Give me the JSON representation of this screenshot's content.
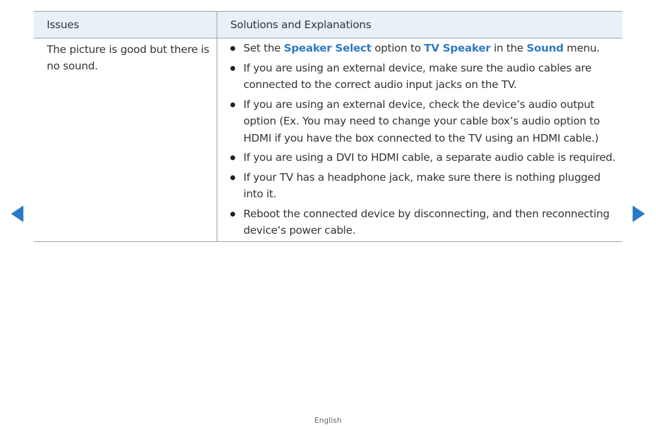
{
  "table": {
    "headers": {
      "issues": "Issues",
      "solutions": "Solutions and Explanations"
    },
    "row": {
      "issue": "The picture is good but there is no sound.",
      "item1": {
        "pre": "Set the ",
        "term1": "Speaker Select",
        "mid1": " option to ",
        "term2": "TV Speaker",
        "mid2": " in the ",
        "term3": "Sound",
        "post": " menu."
      },
      "item2": "If you are using an external device, make sure the audio cables are connected to the correct audio input jacks on the TV.",
      "item3": "If you are using an external device, check the device’s audio output option (Ex. You may need to change your cable box’s audio option to HDMI if you have the box connected to the TV using an HDMI cable.)",
      "item4": "If you are using a DVI to HDMI cable, a separate audio cable is required.",
      "item5": "If your TV has a headphone jack, make sure there is nothing plugged into it.",
      "item6": "Reboot the connected device by disconnecting, and then reconnecting device’s power cable."
    }
  },
  "navigation": {
    "prev_icon": "triangle-left-icon",
    "next_icon": "triangle-right-icon",
    "arrow_color": "#2a7bc7"
  },
  "footer": {
    "language": "English"
  },
  "colors": {
    "highlight": "#2f7bc2",
    "header_background": "#e8f1f8",
    "rule": "#9aa3ad"
  }
}
